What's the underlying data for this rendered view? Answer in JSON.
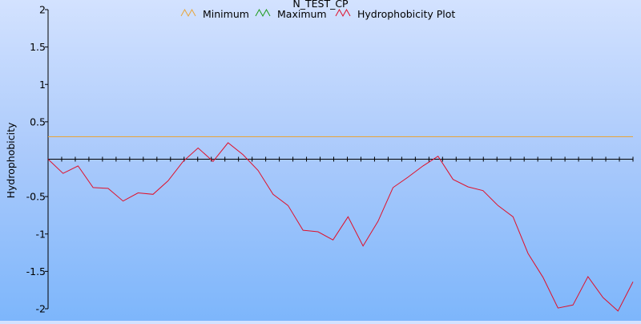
{
  "chart_data": {
    "type": "line",
    "title": "N_TEST_CP",
    "xlabel": "",
    "ylabel": "Hydrophobicity",
    "ylim": [
      -2,
      2
    ],
    "y_ticks": [
      2,
      1.5,
      1,
      0.5,
      -0.5,
      -1,
      -1.5,
      -2
    ],
    "y_tick_labels": [
      "2",
      "1.5",
      "1",
      "0.5",
      "-0.5",
      "-1",
      "-1.5",
      "-2"
    ],
    "x_tick_count": 44,
    "x_tick_labels": [],
    "grid": false,
    "legend_position": "top-center",
    "series": [
      {
        "name": "Minimum",
        "color": "#e8a53a",
        "values": [
          0.3,
          0.3,
          0.3,
          0.3,
          0.3,
          0.3,
          0.3,
          0.3,
          0.3,
          0.3,
          0.3,
          0.3,
          0.3,
          0.3,
          0.3,
          0.3,
          0.3,
          0.3,
          0.3,
          0.3,
          0.3,
          0.3,
          0.3,
          0.3,
          0.3,
          0.3,
          0.3,
          0.3,
          0.3,
          0.3,
          0.3,
          0.3,
          0.3,
          0.3,
          0.3,
          0.3,
          0.3,
          0.3,
          0.3,
          0.3,
          0.3,
          0.3,
          0.3,
          0.3
        ]
      },
      {
        "name": "Maximum",
        "color": "#1a9a1a",
        "values": []
      },
      {
        "name": "Hydrophobicity Plot",
        "color": "#e0102a",
        "values": [
          0.0,
          -0.19,
          -0.09,
          -0.38,
          -0.39,
          -0.56,
          -0.45,
          -0.47,
          -0.29,
          -0.03,
          0.15,
          -0.03,
          0.22,
          0.06,
          -0.15,
          -0.47,
          -0.62,
          -0.95,
          -0.97,
          -1.08,
          -0.77,
          -1.16,
          -0.83,
          -0.38,
          -0.24,
          -0.09,
          0.04,
          -0.27,
          -0.37,
          -0.42,
          -0.62,
          -0.77,
          -1.26,
          -1.58,
          -1.99,
          -1.95,
          -1.57,
          -1.85,
          -2.03,
          -1.64
        ]
      }
    ]
  }
}
